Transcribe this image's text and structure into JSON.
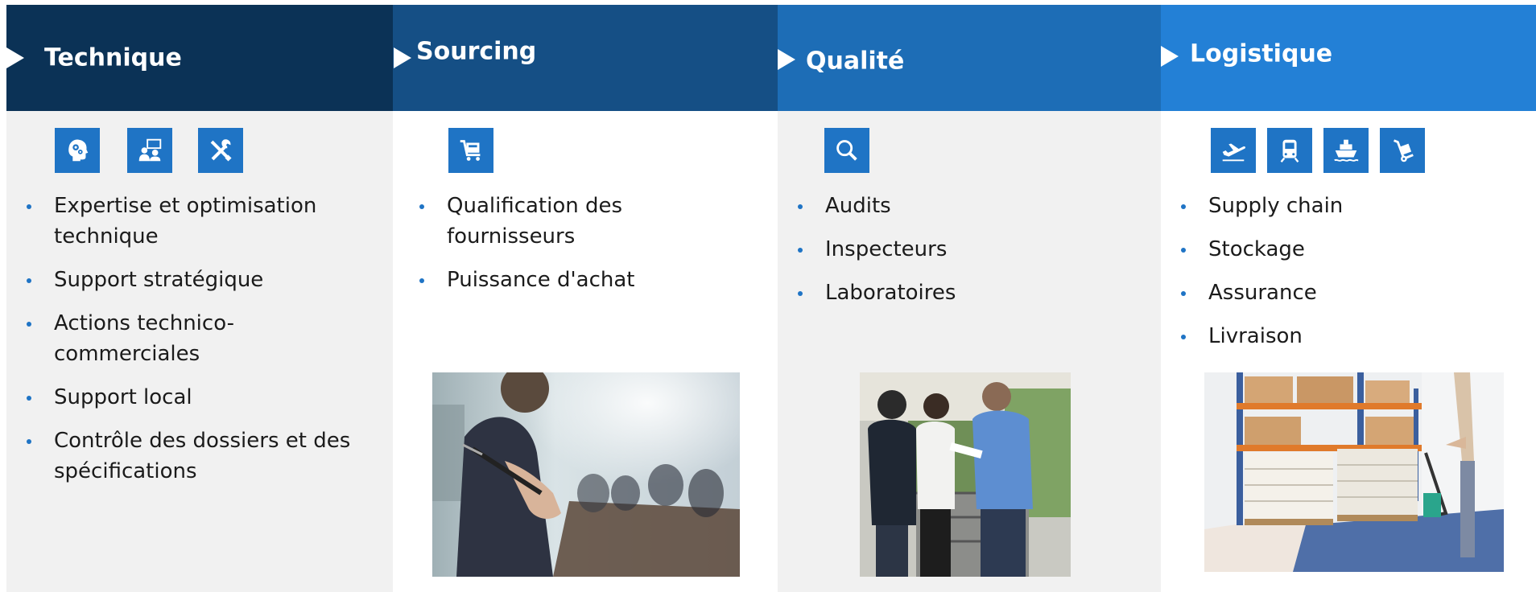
{
  "columns": [
    {
      "title": "Technique",
      "header_color": "#0b3256",
      "body_color": "#f1f1f1",
      "icons": [
        "head-gears-icon",
        "team-board-icon",
        "tools-icon"
      ],
      "items": [
        "Expertise  et optimisation technique",
        "Support stratégique",
        "Actions technico-commerciales",
        "Support local",
        "Contrôle des dossiers et des spécifications"
      ]
    },
    {
      "title": "Sourcing",
      "header_color": "#154f85",
      "body_color": "#ffffff",
      "icons": [
        "shopping-cart-icon"
      ],
      "items": [
        "Qualification des fournisseurs",
        "Puissance d'achat"
      ]
    },
    {
      "title": "Qualité",
      "header_color": "#1d6db6",
      "body_color": "#f1f1f1",
      "icons": [
        "magnifier-icon"
      ],
      "items": [
        "Audits",
        "Inspecteurs",
        "Laboratoires"
      ]
    },
    {
      "title": "Logistique",
      "header_color": "#2380d6",
      "body_color": "#ffffff",
      "icons": [
        "airplane-icon",
        "train-icon",
        "ship-icon",
        "hand-truck-icon"
      ],
      "items": [
        "Supply chain",
        "Stockage",
        "Assurance",
        "Livraison"
      ]
    }
  ],
  "photos": [
    "meeting-photo",
    "inspection-photo",
    "warehouse-photo"
  ],
  "accent_color": "#1f74c5"
}
